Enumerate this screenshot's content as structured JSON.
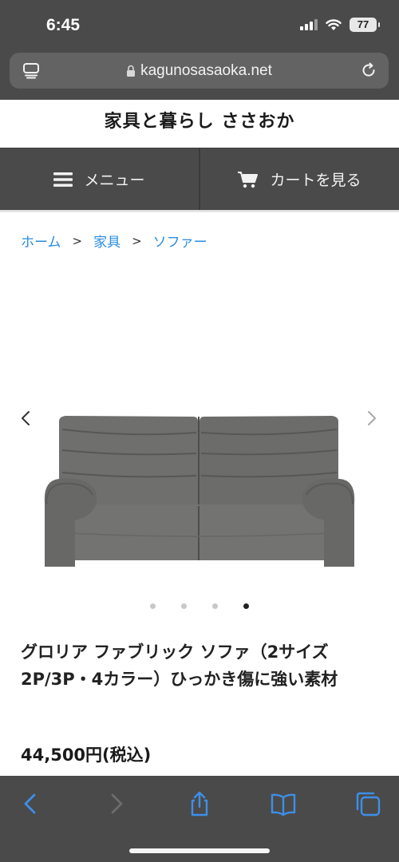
{
  "status_bar": {
    "time": "6:45",
    "battery": "77"
  },
  "browser": {
    "url": "kagunosasaoka.net"
  },
  "site": {
    "title": "家具と暮らし ささおか"
  },
  "nav": {
    "menu_label": "メニュー",
    "cart_label": "カートを見る"
  },
  "breadcrumb": [
    {
      "label": "ホーム"
    },
    {
      "label": "家具"
    },
    {
      "label": "ソファー"
    }
  ],
  "breadcrumb_sep": ">",
  "gallery": {
    "slides": 4,
    "active_slide": 4
  },
  "product": {
    "title": "グロリア ファブリック ソファ（2サイズ 2P/3P・4カラー）ひっかき傷に強い素材",
    "price": "44,500円(税込)"
  },
  "colors": {
    "chrome": "#4a4a4a",
    "link": "#2b8ce0",
    "sofa": "#6e6f6d"
  },
  "icons": [
    "tabs-icon",
    "lock-icon",
    "reload-icon",
    "menu-icon",
    "cart-icon",
    "chevron-left-icon",
    "chevron-right-icon",
    "back-icon",
    "forward-icon",
    "share-icon",
    "bookmarks-icon",
    "tabs-overview-icon"
  ]
}
